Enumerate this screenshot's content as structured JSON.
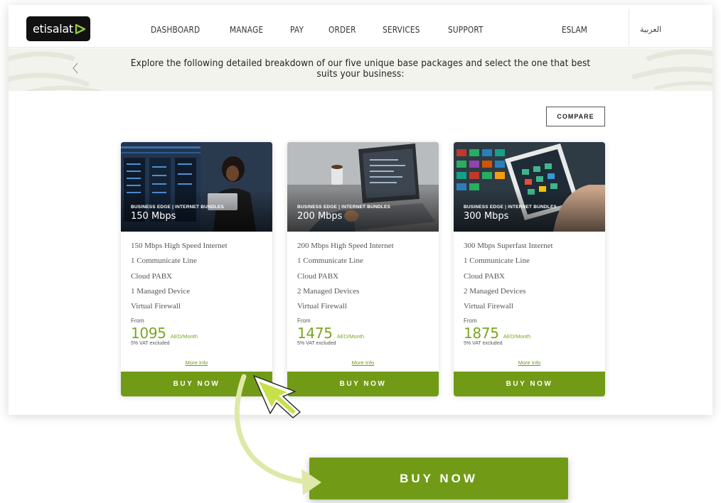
{
  "header": {
    "logo": "etisalat",
    "nav": [
      "DASHBOARD",
      "MANAGE",
      "PAY",
      "ORDER",
      "SERVICES",
      "SUPPORT"
    ],
    "user": "ESLAM",
    "language": "العربية"
  },
  "banner": {
    "text": "Explore the following detailed breakdown of our five unique base packages and select the one that best suits your business:"
  },
  "compare_label": "COMPARE",
  "cards": [
    {
      "category": "BUSINESS EDGE | INTERNET BUNDLES",
      "speed": "150 Mbps",
      "features": [
        "150 Mbps High Speed Internet",
        "1 Communicate Line",
        "Cloud PABX",
        "1 Managed Device",
        "Virtual Firewall"
      ],
      "from": "From",
      "price": "1095",
      "unit": "AED/Month",
      "vat": "5% VAT excluded",
      "more": "More Info",
      "buy": "BUY NOW"
    },
    {
      "category": "BUSINESS EDGE | INTERNET BUNDLES",
      "speed": "200 Mbps",
      "features": [
        "200 Mbps High Speed Internet",
        "1 Communicate Line",
        "Cloud PABX",
        "2 Managed Devices",
        "Virtual Firewall"
      ],
      "from": "From",
      "price": "1475",
      "unit": "AED/Month",
      "vat": "5% VAT excluded",
      "more": "More Info",
      "buy": "BUY NOW"
    },
    {
      "category": "BUSINESS EDGE | INTERNET BUNDLES",
      "speed": "300 Mbps",
      "features": [
        "300 Mbps Superfast Internet",
        "1 Communicate Line",
        "Cloud PABX",
        "2 Managed Devices",
        "Virtual Firewall"
      ],
      "from": "From",
      "price": "1875",
      "unit": "AED/Month",
      "vat": "5% VAT excluded",
      "more": "More Info",
      "buy": "BUY NOW"
    }
  ],
  "zoomed_button": "BUY NOW",
  "colors": {
    "brand_green": "#719b17",
    "price_green": "#7aa620",
    "arrow_lime": "#dfe8a6",
    "cursor_lime": "#c8e04a",
    "banner_bg": "#f3f3ee"
  }
}
